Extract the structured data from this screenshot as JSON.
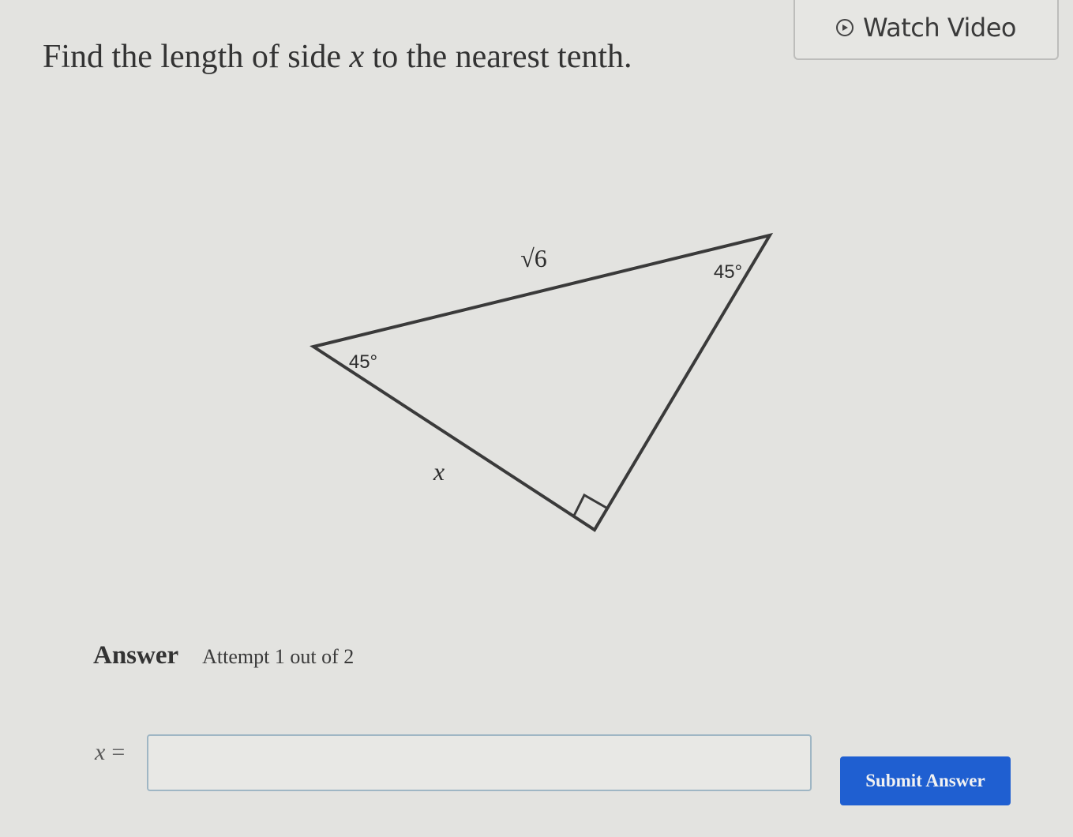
{
  "header": {
    "watch_video_label": "Watch Video",
    "play_icon": "play-circle-icon"
  },
  "question": {
    "prefix": "Find the length of side ",
    "variable": "x",
    "suffix": " to the nearest tenth."
  },
  "figure": {
    "hypotenuse_label": "√6",
    "angle_top": "45°",
    "angle_left": "45°",
    "side_label": "x"
  },
  "answer": {
    "title": "Answer",
    "attempt_text": "Attempt 1 out of 2",
    "variable_label": "x",
    "equals": "=",
    "input_value": "",
    "input_placeholder": "",
    "submit_label": "Submit Answer"
  },
  "colors": {
    "background": "#e3e3e0",
    "submit_button": "#1f5fd1",
    "input_border": "#9fb6c4"
  }
}
